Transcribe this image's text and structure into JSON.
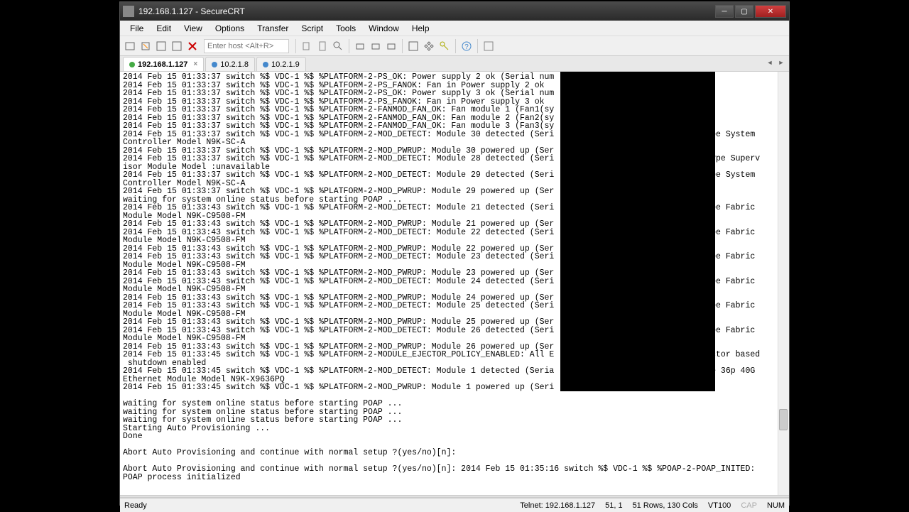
{
  "window": {
    "title": "192.168.1.127 - SecureCRT"
  },
  "menubar": {
    "items": [
      "File",
      "Edit",
      "View",
      "Options",
      "Transfer",
      "Script",
      "Tools",
      "Window",
      "Help"
    ]
  },
  "toolbar": {
    "host_placeholder": "Enter host <Alt+R>"
  },
  "tabs": [
    {
      "label": "192.168.1.127",
      "active": true,
      "dot": "green",
      "closable": true
    },
    {
      "label": "10.2.1.8",
      "active": false,
      "dot": "blue",
      "closable": false
    },
    {
      "label": "10.2.1.9",
      "active": false,
      "dot": "blue",
      "closable": false
    }
  ],
  "terminal": {
    "lines": [
      "2014 Feb 15 01:33:37 switch %$ VDC-1 %$ %PLATFORM-2-PS_OK: Power supply 2 ok (Serial num",
      "2014 Feb 15 01:33:37 switch %$ VDC-1 %$ %PLATFORM-2-PS_FANOK: Fan in Power supply 2 ok",
      "2014 Feb 15 01:33:37 switch %$ VDC-1 %$ %PLATFORM-2-PS_OK: Power supply 3 ok (Serial num",
      "2014 Feb 15 01:33:37 switch %$ VDC-1 %$ %PLATFORM-2-PS_FANOK: Fan in Power supply 3 ok",
      "2014 Feb 15 01:33:37 switch %$ VDC-1 %$ %PLATFORM-2-FANMOD_FAN_OK: Fan module 1 (Fan1(sy",
      "2014 Feb 15 01:33:37 switch %$ VDC-1 %$ %PLATFORM-2-FANMOD_FAN_OK: Fan module 2 (Fan2(sy",
      "2014 Feb 15 01:33:37 switch %$ VDC-1 %$ %PLATFORM-2-FANMOD_FAN_OK: Fan module 3 (Fan3(sy",
      "2014 Feb 15 01:33:37 switch %$ VDC-1 %$ %PLATFORM-2-MOD_DETECT: Module 30 detected (Seri                              Type System",
      "Controller Model N9K-SC-A",
      "2014 Feb 15 01:33:37 switch %$ VDC-1 %$ %PLATFORM-2-MOD_PWRUP: Module 30 powered up (Ser",
      "2014 Feb 15 01:33:37 switch %$ VDC-1 %$ %PLATFORM-2-MOD_DETECT: Module 28 detected (Seri                              -Type Superv",
      "isor Module Model :unavailable",
      "2014 Feb 15 01:33:37 switch %$ VDC-1 %$ %PLATFORM-2-MOD_DETECT: Module 29 detected (Seri                              Type System",
      "Controller Model N9K-SC-A",
      "2014 Feb 15 01:33:37 switch %$ VDC-1 %$ %PLATFORM-2-MOD_PWRUP: Module 29 powered up (Ser",
      "waiting for system online status before starting POAP ...",
      "2014 Feb 15 01:33:43 switch %$ VDC-1 %$ %PLATFORM-2-MOD_DETECT: Module 21 detected (Seri                              Type Fabric",
      "Module Model N9K-C9508-FM",
      "2014 Feb 15 01:33:43 switch %$ VDC-1 %$ %PLATFORM-2-MOD_PWRUP: Module 21 powered up (Ser",
      "2014 Feb 15 01:33:43 switch %$ VDC-1 %$ %PLATFORM-2-MOD_DETECT: Module 22 detected (Seri                              Type Fabric",
      "Module Model N9K-C9508-FM",
      "2014 Feb 15 01:33:43 switch %$ VDC-1 %$ %PLATFORM-2-MOD_PWRUP: Module 22 powered up (Ser",
      "2014 Feb 15 01:33:43 switch %$ VDC-1 %$ %PLATFORM-2-MOD_DETECT: Module 23 detected (Seri                              Type Fabric",
      "Module Model N9K-C9508-FM",
      "2014 Feb 15 01:33:43 switch %$ VDC-1 %$ %PLATFORM-2-MOD_PWRUP: Module 23 powered up (Ser",
      "2014 Feb 15 01:33:43 switch %$ VDC-1 %$ %PLATFORM-2-MOD_DETECT: Module 24 detected (Seri                              Type Fabric",
      "Module Model N9K-C9508-FM",
      "2014 Feb 15 01:33:43 switch %$ VDC-1 %$ %PLATFORM-2-MOD_PWRUP: Module 24 powered up (Ser",
      "2014 Feb 15 01:33:43 switch %$ VDC-1 %$ %PLATFORM-2-MOD_DETECT: Module 25 detected (Seri                              Type Fabric",
      "Module Model N9K-C9508-FM",
      "2014 Feb 15 01:33:43 switch %$ VDC-1 %$ %PLATFORM-2-MOD_PWRUP: Module 25 powered up (Ser",
      "2014 Feb 15 01:33:43 switch %$ VDC-1 %$ %PLATFORM-2-MOD_DETECT: Module 26 detected (Seri                              Type Fabric",
      "Module Model N9K-C9508-FM",
      "2014 Feb 15 01:33:43 switch %$ VDC-1 %$ %PLATFORM-2-MOD_PWRUP: Module 26 powered up (Ser",
      "2014 Feb 15 01:33:45 switch %$ VDC-1 %$ %PLATFORM-2-MODULE_EJECTOR_POLICY_ENABLED: All E                              jector based",
      " shutdown enabled",
      "2014 Feb 15 01:33:45 switch %$ VDC-1 %$ %PLATFORM-2-MOD_DETECT: Module 1 detected (Seria                              ype 36p 40G",
      "Ethernet Module Model N9K-X9636PQ",
      "2014 Feb 15 01:33:45 switch %$ VDC-1 %$ %PLATFORM-2-MOD_PWRUP: Module 1 powered up (Seri",
      "",
      "waiting for system online status before starting POAP ...",
      "waiting for system online status before starting POAP ...",
      "waiting for system online status before starting POAP ...",
      "Starting Auto Provisioning ...",
      "Done",
      "",
      "Abort Auto Provisioning and continue with normal setup ?(yes/no)[n]:",
      "",
      "Abort Auto Provisioning and continue with normal setup ?(yes/no)[n]: 2014 Feb 15 01:35:16 switch %$ VDC-1 %$ %POAP-2-POAP_INITED:",
      "POAP process initialized",
      ""
    ]
  },
  "statusbar": {
    "ready": "Ready",
    "connection": "Telnet: 192.168.1.127",
    "position": "51,  1",
    "size": "51 Rows, 130 Cols",
    "emulation": "VT100",
    "caps": "CAP",
    "num": "NUM"
  }
}
